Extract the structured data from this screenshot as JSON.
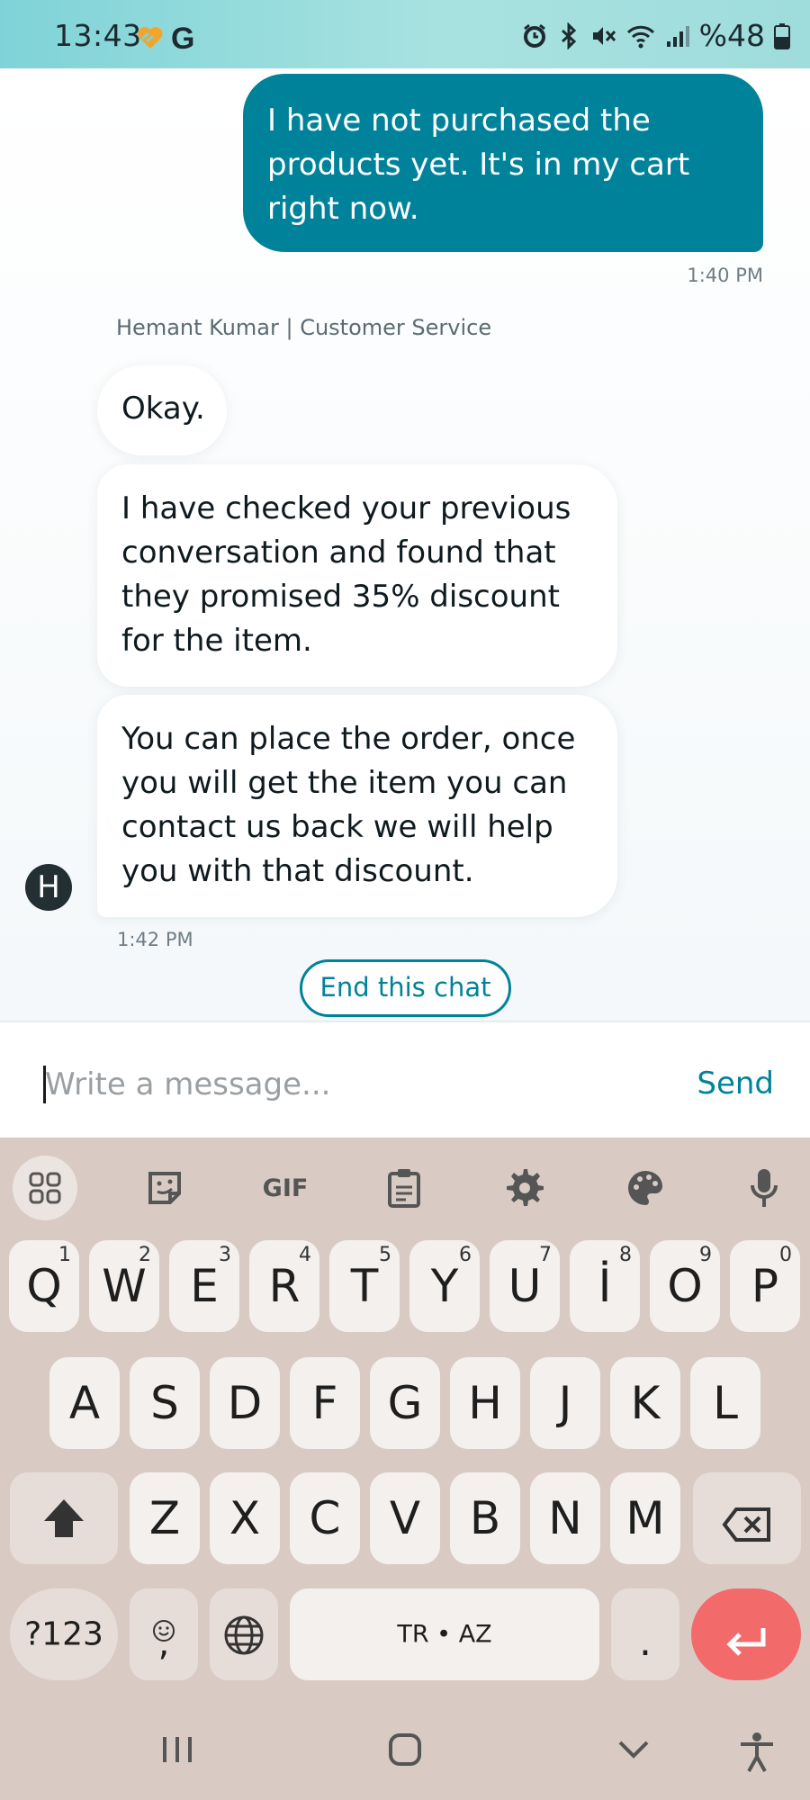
{
  "status_bar": {
    "time": "13:43",
    "app_icon_g": "G",
    "battery": "%48",
    "icons": [
      "heart-icon",
      "g-icon",
      "alarm-icon",
      "bluetooth-icon",
      "mute-icon",
      "wifi-icon",
      "signal-icon",
      "battery-icon"
    ]
  },
  "chat": {
    "outgoing": {
      "text": "I have not purchased the products yet. It's in my cart right now.",
      "time": "1:40 PM"
    },
    "agent_name": "Hemant Kumar | Customer Service",
    "agent_initial": "H",
    "incoming": [
      "Okay.",
      "I have checked your previous conversation and found that they promised 35% discount for the item.",
      "You can place the order, once you will get the item you can contact us back we will help you with that discount."
    ],
    "incoming_time": "1:42 PM",
    "end_chat_label": "End this chat",
    "colors": {
      "accent": "#00839a",
      "bubble_in": "#ffffff"
    }
  },
  "composer": {
    "placeholder": "Write a message...",
    "value": "",
    "send_label": "Send"
  },
  "keyboard": {
    "toolbar": [
      "apps-icon",
      "sticker-icon",
      "gif-icon",
      "clipboard-icon",
      "settings-icon",
      "palette-icon",
      "microphone-icon"
    ],
    "gif_label": "GIF",
    "row1": [
      {
        "k": "Q",
        "h": "1"
      },
      {
        "k": "W",
        "h": "2"
      },
      {
        "k": "E",
        "h": "3"
      },
      {
        "k": "R",
        "h": "4"
      },
      {
        "k": "T",
        "h": "5"
      },
      {
        "k": "Y",
        "h": "6"
      },
      {
        "k": "U",
        "h": "7"
      },
      {
        "k": "İ",
        "h": "8"
      },
      {
        "k": "O",
        "h": "9"
      },
      {
        "k": "P",
        "h": "0"
      }
    ],
    "row2": [
      "A",
      "S",
      "D",
      "F",
      "G",
      "H",
      "J",
      "K",
      "L"
    ],
    "row3": [
      "Z",
      "X",
      "C",
      "V",
      "B",
      "N",
      "M"
    ],
    "symbols_label": "?123",
    "comma_label": ",",
    "space_label": "TR • AZ",
    "period_label": ".",
    "colors": {
      "background": "#d9cbc4",
      "enter": "#f26a6a"
    }
  },
  "navbar": [
    "recents-icon",
    "home-icon",
    "hide-keyboard-icon",
    "accessibility-icon"
  ]
}
